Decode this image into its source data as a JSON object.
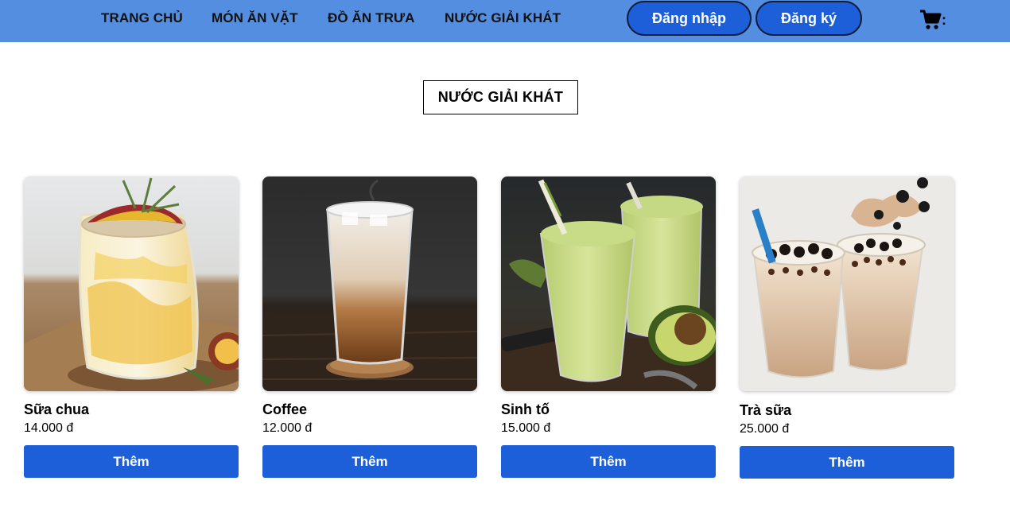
{
  "nav": {
    "items": [
      {
        "label": "TRANG CHỦ"
      },
      {
        "label": "MÓN ĂN VẶT"
      },
      {
        "label": "ĐỒ ĂN TRƯA"
      },
      {
        "label": "NƯỚC GIẢI KHÁT"
      }
    ],
    "login_label": "Đăng nhập",
    "register_label": "Đăng ký",
    "cart_icon": "shopping-cart-icon",
    "cart_suffix": ":"
  },
  "section": {
    "title": "NƯỚC GIẢI KHÁT"
  },
  "products": [
    {
      "name": "Sữa chua",
      "price": "14.000 đ",
      "add_label": "Thêm",
      "image": "yogurt-drink-photo"
    },
    {
      "name": "Coffee",
      "price": "12.000 đ",
      "add_label": "Thêm",
      "image": "iced-coffee-photo"
    },
    {
      "name": "Sinh tố",
      "price": "15.000 đ",
      "add_label": "Thêm",
      "image": "avocado-smoothie-photo"
    },
    {
      "name": "Trà sữa",
      "price": "25.000 đ",
      "add_label": "Thêm",
      "image": "bubble-milk-tea-photo"
    }
  ],
  "colors": {
    "header_bg": "#538ee0",
    "button_bg": "#1c5fd9",
    "button_text": "#ffffff"
  }
}
